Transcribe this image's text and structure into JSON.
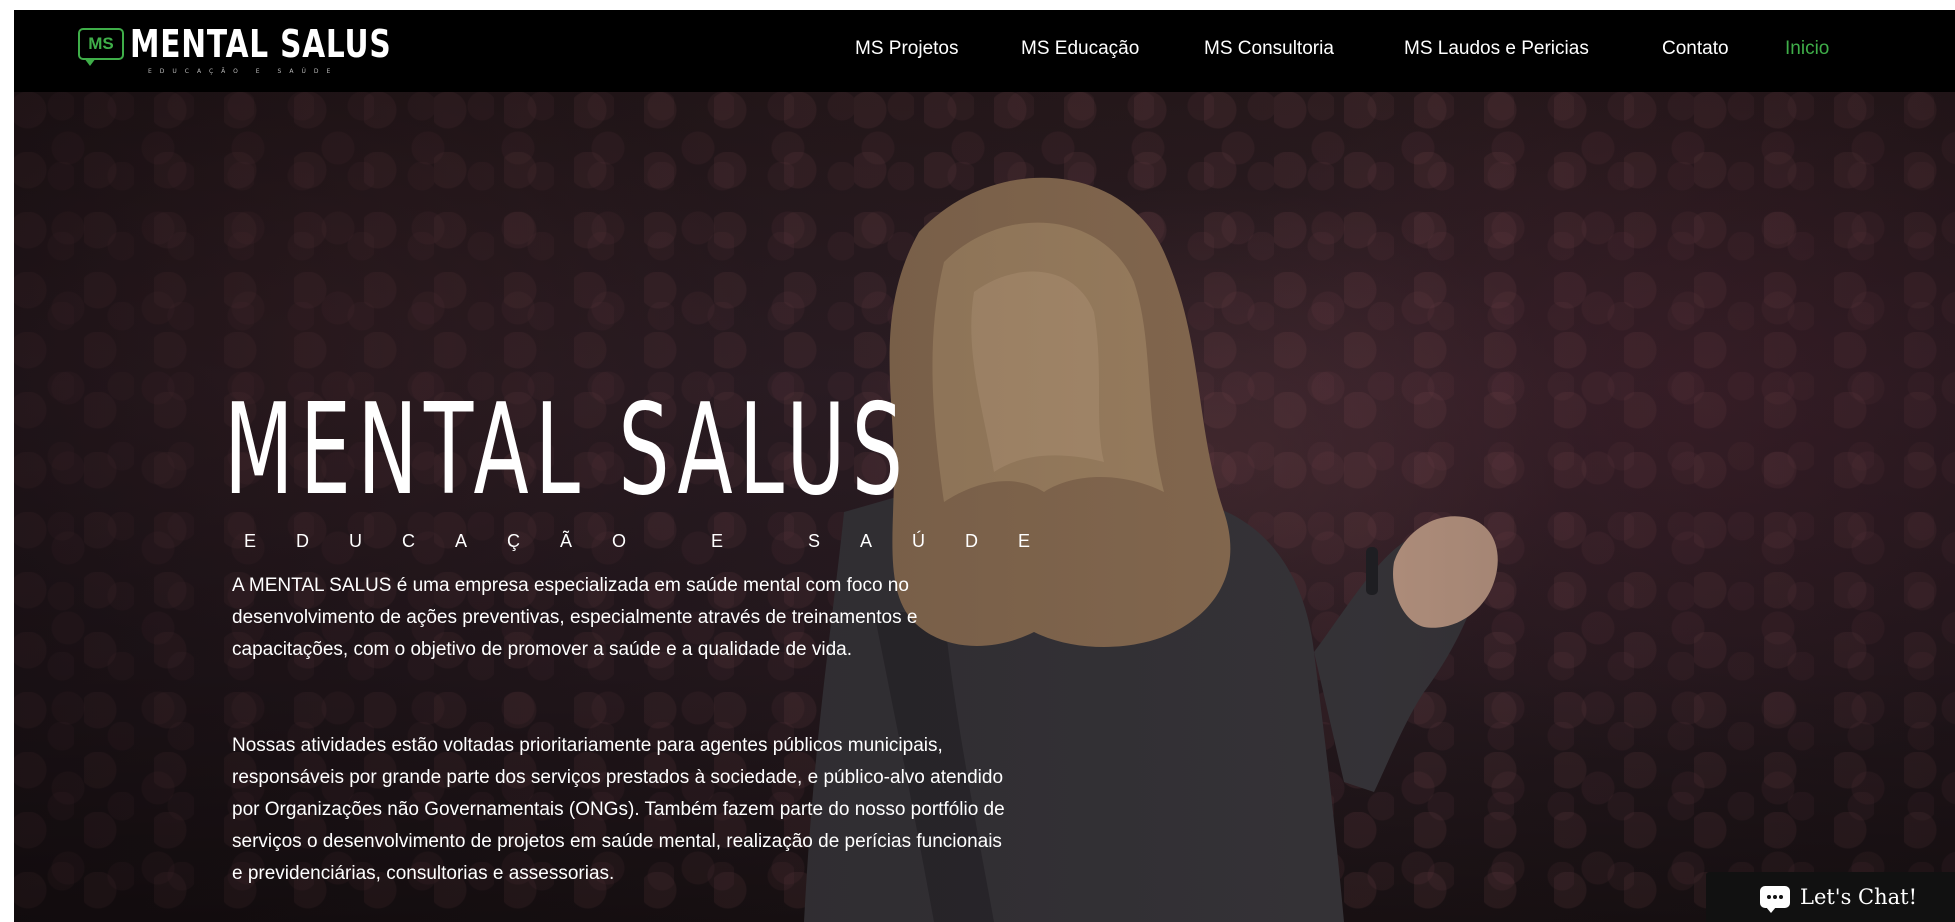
{
  "brand": {
    "badge": "MS",
    "name": "MENTAL SALUS",
    "tagline": "EDUCAÇÃO E SAÚDE",
    "accent_color": "#3fae49"
  },
  "nav": {
    "items": [
      {
        "label": "MS Projetos",
        "active": false
      },
      {
        "label": "MS Educação",
        "active": false
      },
      {
        "label": "MS Consultoria",
        "active": false
      },
      {
        "label": "MS Laudos e Pericias",
        "active": false
      },
      {
        "label": "Contato",
        "active": false
      },
      {
        "label": "Inicio",
        "active": true
      }
    ]
  },
  "hero": {
    "title": "MENTAL SALUS",
    "subtitle": "EDUCAÇÃO E SAÚDE",
    "paragraph_1": "A MENTAL SALUS é uma empresa especializada em saúde mental com foco no desenvolvimento de ações preventivas, especialmente através de treinamentos e capacitações, com o objetivo de promover a saúde e a qualidade de vida.",
    "paragraph_2": "Nossas atividades estão voltadas prioritariamente para agentes públicos municipais, responsáveis por grande parte dos serviços prestados à sociedade, e público-alvo atendido por Organizações não Governamentais (ONGs). Também fazem parte do nosso portfólio de serviços o desenvolvimento de projetos em saúde mental, realização de perícias funcionais e previdenciárias, consultorias e assessorias."
  },
  "chat": {
    "label": "Let's Chat!",
    "icon": "chat-bubble-icon"
  }
}
